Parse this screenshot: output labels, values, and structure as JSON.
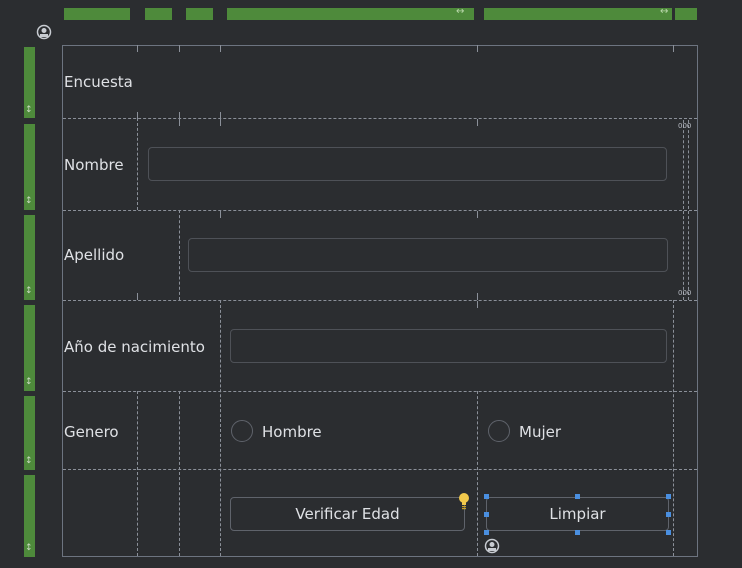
{
  "form": {
    "title": "Encuesta",
    "rows": {
      "nombre_label": "Nombre",
      "apellido_label": "Apellido",
      "anio_label": "Año de nacimiento",
      "genero_label": "Genero"
    },
    "inputs": {
      "nombre_value": "",
      "apellido_value": "",
      "anio_value": ""
    },
    "radios": {
      "hombre": "Hombre",
      "mujer": "Mujer"
    },
    "buttons": {
      "verificar": "Verificar Edad",
      "limpiar": "Limpiar"
    }
  },
  "designer": {
    "scroll_top_label": "000",
    "scroll_bottom_label": "000",
    "resize_glyph": "↔",
    "row_resize_glyph": "↕",
    "accent_color": "#4e8a3b",
    "selection_color": "#4a8fe0",
    "bulb_color": "#f2c94c"
  }
}
